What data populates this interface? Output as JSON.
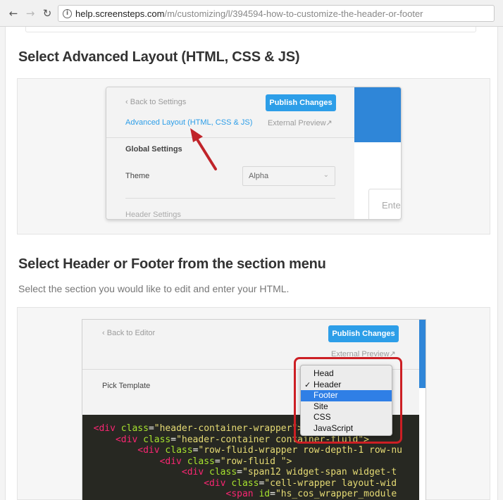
{
  "browser": {
    "url_host": "help.screensteps.com",
    "url_path": "/m/customizing/l/394594-how-to-customize-the-header-or-footer",
    "back_icon": "arrow-left-icon",
    "forward_icon": "arrow-right-icon",
    "reload_icon": "reload-icon",
    "info_icon": "info-icon"
  },
  "sections": [
    {
      "heading": "Select Advanced Layout (HTML, CSS & JS)",
      "screenshot": {
        "back_link": "Back to Settings",
        "publish_button": "Publish Changes",
        "advanced_link": "Advanced Layout (HTML, CSS & JS)",
        "external_preview": "External Preview",
        "global_settings": "Global Settings",
        "theme_label": "Theme",
        "theme_value": "Alpha",
        "header_settings": "Header Settings",
        "input_placeholder": "Ente"
      }
    },
    {
      "heading": "Select Header or Footer from the section menu",
      "description": "Select the section you would like to edit and enter your HTML.",
      "screenshot": {
        "back_link": "Back to Editor",
        "publish_button": "Publish Changes",
        "external_preview": "External Preview",
        "pick_template": "Pick Template",
        "menu_items": [
          "Head",
          "Header",
          "Footer",
          "Site",
          "CSS",
          "JavaScript"
        ],
        "checked_item": "Header",
        "highlighted_item": "Footer",
        "code_lines": [
          {
            "indent": "",
            "class": "header-container-wrapper",
            "tag": "div",
            "attr": "class",
            "tail": "\">"
          },
          {
            "indent": "    ",
            "class": "header-container container-fluid",
            "tag": "div",
            "attr": "class",
            "tail": "\">"
          },
          {
            "indent": "        ",
            "class": "row-fluid-wrapper row-depth-1 row-nu",
            "tag": "div",
            "attr": "class",
            "tail": ""
          },
          {
            "indent": "            ",
            "class": "row-fluid ",
            "tag": "div",
            "attr": "class",
            "tail": "\">"
          },
          {
            "indent": "                ",
            "class": "span12 widget-span widget-t",
            "tag": "div",
            "attr": "class",
            "tail": ""
          },
          {
            "indent": "                    ",
            "class": "cell-wrapper layout-wid",
            "tag": "div",
            "attr": "class",
            "tail": ""
          },
          {
            "indent": "                        ",
            "class": "hs_cos_wrapper_module",
            "tag": "span",
            "attr": "id",
            "tail": ""
          }
        ]
      }
    }
  ],
  "colors": {
    "accent_blue": "#2d9ee8",
    "annotation_red": "#cc1f24",
    "code_background": "#272822"
  }
}
